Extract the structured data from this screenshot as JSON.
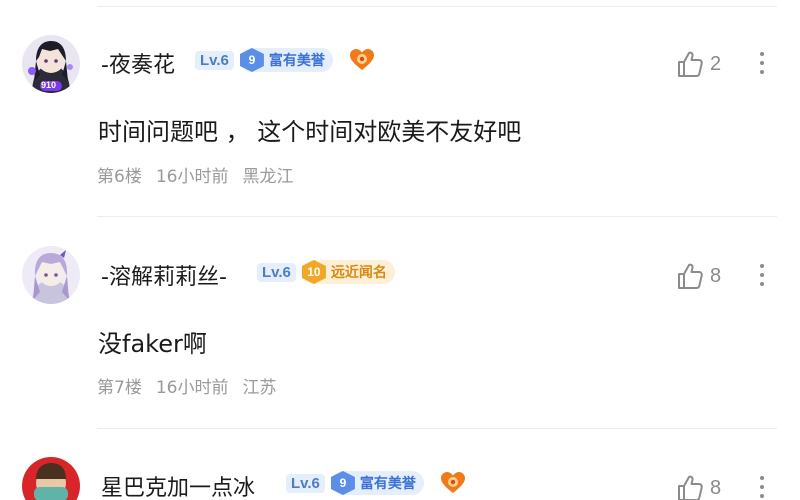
{
  "comments": [
    {
      "username": "-夜奏花",
      "level": "Lv.6",
      "honor_level": "9",
      "honor_title": "富有美誉",
      "honor_style": "blue",
      "has_heart_badge": true,
      "avatar_badge_text": "910",
      "like_count": "2",
      "content": "时间问题吧 ， 这个时间对欧美不友好吧",
      "floor": "第6楼",
      "time": "16小时前",
      "location": "黑龙江"
    },
    {
      "username": "-溶解莉莉丝-",
      "level": "Lv.6",
      "honor_level": "10",
      "honor_title": "远近闻名",
      "honor_style": "gold",
      "has_heart_badge": false,
      "like_count": "8",
      "content": "没faker啊",
      "floor": "第7楼",
      "time": "16小时前",
      "location": "江苏"
    },
    {
      "username": "星巴克加一点冰",
      "level": "Lv.6",
      "honor_level": "9",
      "honor_title": "富有美誉",
      "honor_style": "blue",
      "has_heart_badge": true,
      "like_count": "8"
    }
  ],
  "colors": {
    "level_badge": "#4f7cc2",
    "honor_blue": "#3c72d6",
    "honor_gold": "#d98a14",
    "meta_text": "#9a9a9a",
    "heart_badge": "#f07a1a"
  },
  "icons": {
    "like": "thumbs-up-outline-icon",
    "more": "vertical-ellipsis-icon",
    "heart_badge": "heart-badge-icon"
  }
}
